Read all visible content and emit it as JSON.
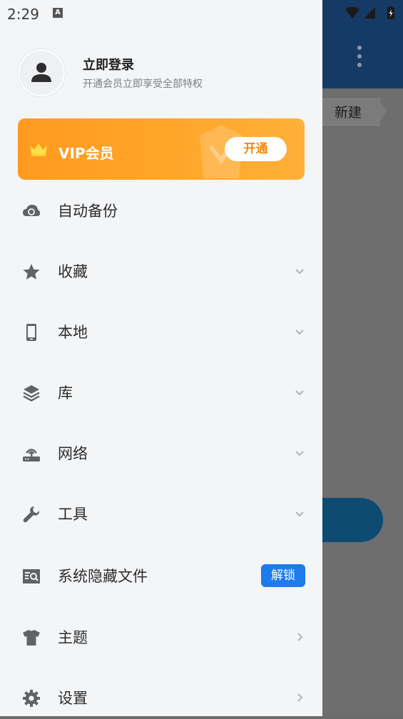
{
  "status_bar": {
    "time": "2:29",
    "notification_icon": "A"
  },
  "background": {
    "breadcrumb": "新建"
  },
  "profile": {
    "title": "立即登录",
    "subtitle": "开通会员立即享受全部特权"
  },
  "vip": {
    "label": "VIP会员",
    "button": "开通"
  },
  "menu": [
    {
      "label": "自动备份",
      "icon": "cloud-sync-icon"
    },
    {
      "label": "收藏",
      "icon": "star-icon"
    },
    {
      "label": "本地",
      "icon": "phone-icon"
    },
    {
      "label": "库",
      "icon": "layers-icon"
    },
    {
      "label": "网络",
      "icon": "router-icon"
    },
    {
      "label": "工具",
      "icon": "wrench-icon"
    },
    {
      "label": "系统隐藏文件",
      "icon": "hidden-file-icon",
      "badge": "解锁"
    },
    {
      "label": "主题",
      "icon": "tshirt-icon"
    },
    {
      "label": "设置",
      "icon": "gear-icon"
    }
  ],
  "colors": {
    "accent": "#1e7bea",
    "vip": "#ffa629",
    "appbar": "#163a66"
  }
}
